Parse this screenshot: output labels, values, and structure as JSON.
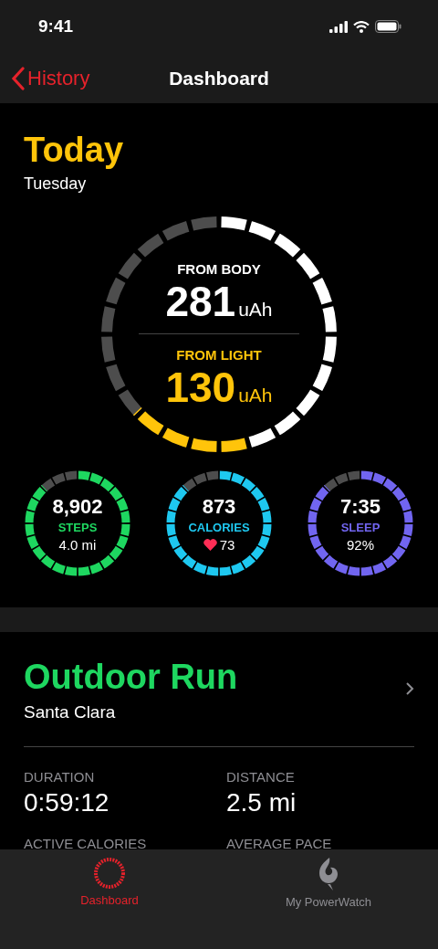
{
  "status_bar": {
    "time": "9:41"
  },
  "nav": {
    "back": "History",
    "title": "Dashboard"
  },
  "today": {
    "title": "Today",
    "day": "Tuesday"
  },
  "energy": {
    "sections": [
      {
        "label": "FROM BODY",
        "value": "281",
        "unit": "uAh",
        "color": "#ffffff",
        "level": 0.46
      },
      {
        "label": "FROM LIGHT",
        "value": "130",
        "unit": "uAh",
        "color": "#ffc40a",
        "level": 0.17
      }
    ]
  },
  "activity": [
    {
      "kind": "plain",
      "value": "8,902",
      "label": "STEPS",
      "detail": "4.0 mi",
      "color": "#1ed760",
      "level": 0.88
    },
    {
      "kind": "heart-rate",
      "value": "873",
      "label": "CALORIES",
      "detail": "73",
      "color": "#1ec8f0",
      "level": 0.88
    },
    {
      "kind": "plain",
      "value": "7:35",
      "label": "SLEEP",
      "detail": "92%",
      "color": "#7165f0",
      "level": 0.88
    }
  ],
  "workout": {
    "title": "Outdoor Run",
    "place": "Santa Clara",
    "stats": [
      {
        "label": "DURATION",
        "value": "0:59:12"
      },
      {
        "label": "DISTANCE",
        "value": "2.5 mi"
      },
      {
        "label": "ACTIVE CALORIES"
      },
      {
        "label": "AVERAGE PACE"
      }
    ]
  },
  "tabs": [
    {
      "label": "Dashboard",
      "selected": true,
      "kind": "ring"
    },
    {
      "label": "My PowerWatch",
      "selected": false,
      "kind": "logo"
    }
  ]
}
